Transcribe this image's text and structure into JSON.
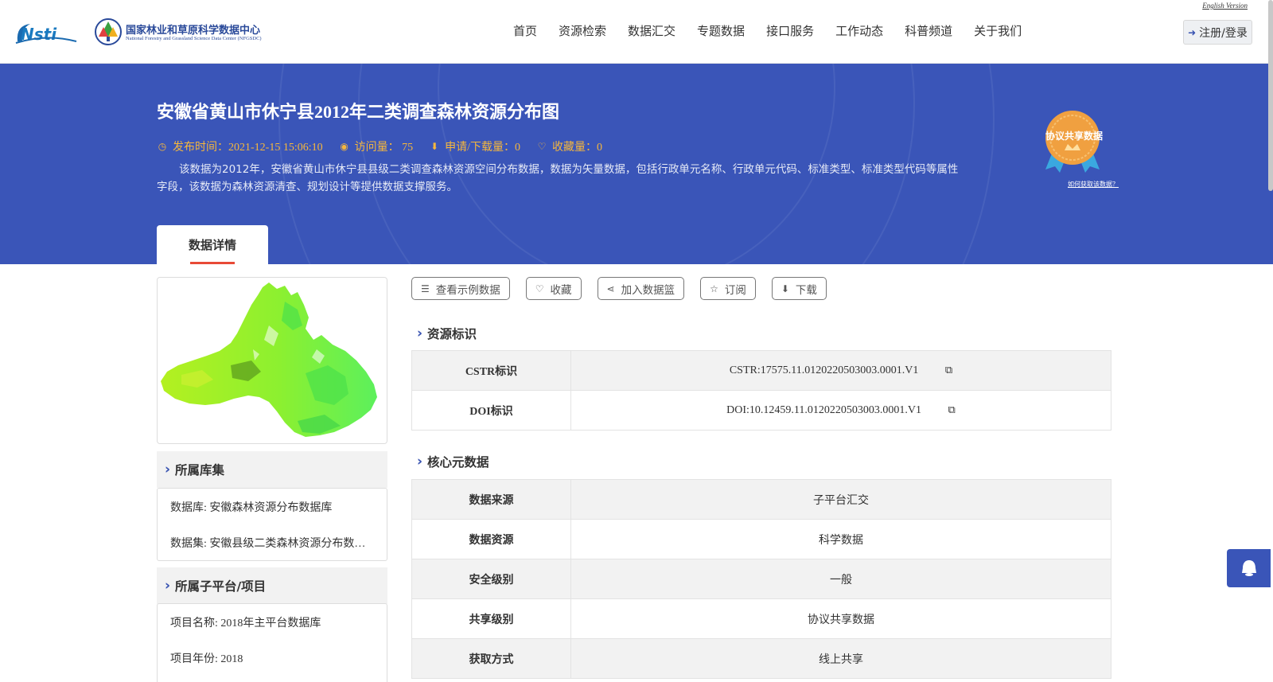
{
  "header": {
    "english_link": "English Version",
    "logo_cn": "国家林业和草原科学数据中心",
    "logo_en": "National Forestry and Grassland Science Data Center (NFGSDC)",
    "nav": [
      "首页",
      "资源检索",
      "数据汇交",
      "专题数据",
      "接口服务",
      "工作动态",
      "科普频道",
      "关于我们"
    ],
    "login_label": "注册/登录"
  },
  "hero": {
    "title": "安徽省黄山市休宁县2012年二类调查森林资源分布图",
    "publish_time": "发布时间：2021-12-15 15:06:10",
    "visits": "访问量： 75",
    "downloads": "申请/下载量：0",
    "favorites": "收藏量：0",
    "description": "该数据为2012年，安徽省黄山市休宁县县级二类调查森林资源空间分布数据，数据为矢量数据，包括行政单元名称、行政单元代码、标准类型、标准类型代码等属性字段，该数据为森林资源清查、规划设计等提供数据支撑服务。",
    "badge_text": "协议共享数据",
    "badge_link": "如何获取该数据？",
    "tab_label": "数据详情"
  },
  "sidebar": {
    "collection_title": "所属库集",
    "database": "数据库: 安徽森林资源分布数据库",
    "dataset": "数据集: 安徽县级二类森林资源分布数…",
    "project_title": "所属子平台/项目",
    "project_name": "项目名称: 2018年主平台数据库",
    "project_year": "项目年份: 2018"
  },
  "actions": {
    "sample": "查看示例数据",
    "favorite": "收藏",
    "basket": "加入数据篮",
    "subscribe": "订阅",
    "download": "下载"
  },
  "resource_id": {
    "title": "资源标识",
    "rows": [
      {
        "key": "CSTR标识",
        "value": "CSTR:17575.11.0120220503003.0001.V1"
      },
      {
        "key": "DOI标识",
        "value": "DOI:10.12459.11.0120220503003.0001.V1"
      }
    ]
  },
  "core_meta": {
    "title": "核心元数据",
    "rows": [
      {
        "key": "数据来源",
        "value": "子平台汇交"
      },
      {
        "key": "数据资源",
        "value": "科学数据"
      },
      {
        "key": "安全级别",
        "value": "一般"
      },
      {
        "key": "共享级别",
        "value": "协议共享数据"
      },
      {
        "key": "获取方式",
        "value": "线上共享"
      }
    ]
  },
  "colors": {
    "hero_bg": "#3a55b8",
    "accent_orange": "#f6b73c",
    "tab_underline": "#e84a36",
    "map_green": "#5cf05c",
    "map_yellowgreen": "#b4f020"
  }
}
